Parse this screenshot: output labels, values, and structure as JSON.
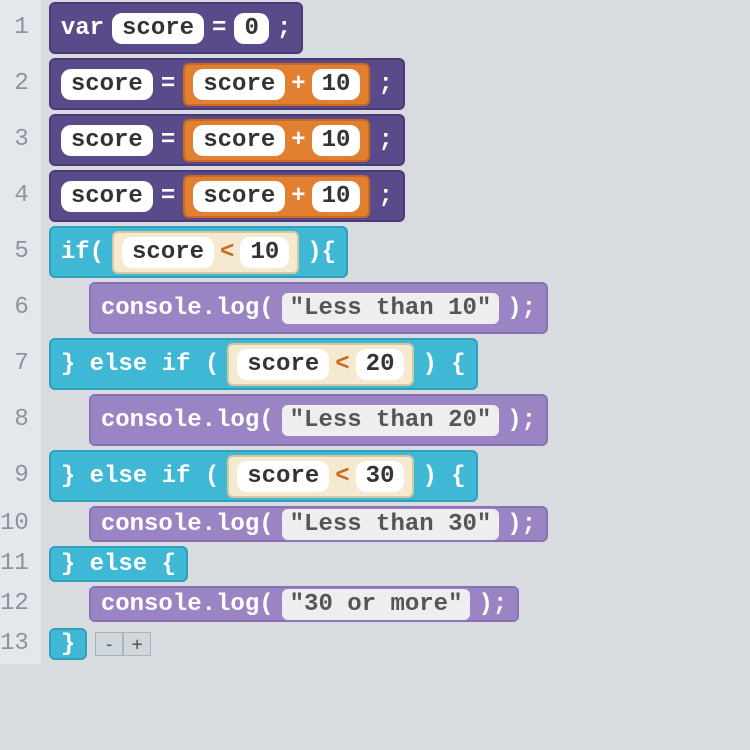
{
  "lines": [
    "1",
    "2",
    "3",
    "4",
    "5",
    "6",
    "7",
    "8",
    "9",
    "10",
    "11",
    "12",
    "13"
  ],
  "l1": {
    "kw": "var",
    "var": "score",
    "eq": "=",
    "val": "0",
    "sc": ";"
  },
  "assign": {
    "var": "score",
    "eq": "=",
    "rhs_var": "score",
    "op": "+",
    "rhs_val": "10",
    "sc": ";"
  },
  "if1": {
    "pre": "if(",
    "var": "score",
    "op": "<",
    "val": "10",
    "post": "){"
  },
  "log1": {
    "fn": "console.log(",
    "str": "\"Less than 10\"",
    "post": ");"
  },
  "elif1": {
    "pre": "} else if (",
    "var": "score",
    "op": "<",
    "val": "20",
    "post": ") {"
  },
  "log2": {
    "fn": "console.log(",
    "str": "\"Less than 20\"",
    "post": ");"
  },
  "elif2": {
    "pre": "} else if (",
    "var": "score",
    "op": "<",
    "val": "30",
    "post": ") {"
  },
  "log3": {
    "fn": "console.log(",
    "str": "\"Less than 30\"",
    "post": ");"
  },
  "else": {
    "txt": "} else {"
  },
  "log4": {
    "fn": "console.log(",
    "str": "\"30 or more\"",
    "post": ");"
  },
  "end": {
    "txt": "}"
  },
  "zoom": {
    "minus": "-",
    "plus": "+"
  }
}
